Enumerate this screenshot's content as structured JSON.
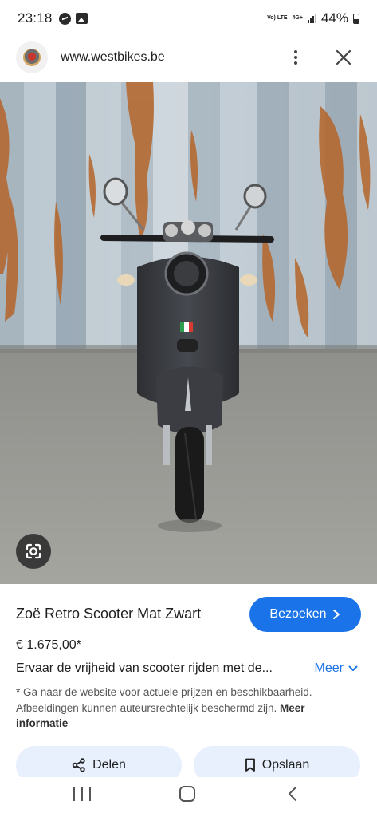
{
  "status_bar": {
    "time": "23:18",
    "left_icons": [
      "messenger-icon",
      "gallery-icon"
    ],
    "network_volte": "Vo) LTE",
    "network_type": "4G+",
    "battery_percent": "44%",
    "battery_level": 0.44
  },
  "url_bar": {
    "url": "www.westbikes.be",
    "favicon": "westbikes-logo",
    "menu_icon": "more-vert-icon",
    "close_icon": "close-icon"
  },
  "image": {
    "subject": "scooter-photo",
    "lens_icon": "google-lens-icon"
  },
  "product": {
    "title": "Zoë Retro Scooter Mat Zwart",
    "visit_label": "Bezoeken",
    "price": "€ 1.675,00*",
    "description": "Ervaar de vrijheid van scooter rijden met de...",
    "more_label": "Meer",
    "disclaimer": "* Ga naar de website voor actuele prijzen en beschikbaarheid. Afbeeldingen kunnen auteursrechtelijk beschermd zijn.",
    "disclaimer_link": "Meer informatie"
  },
  "actions": {
    "share_label": "Delen",
    "save_label": "Opslaan"
  },
  "colors": {
    "accent": "#1a73e8",
    "action_bg": "#e8f0fe",
    "text": "#1f1f1f"
  }
}
